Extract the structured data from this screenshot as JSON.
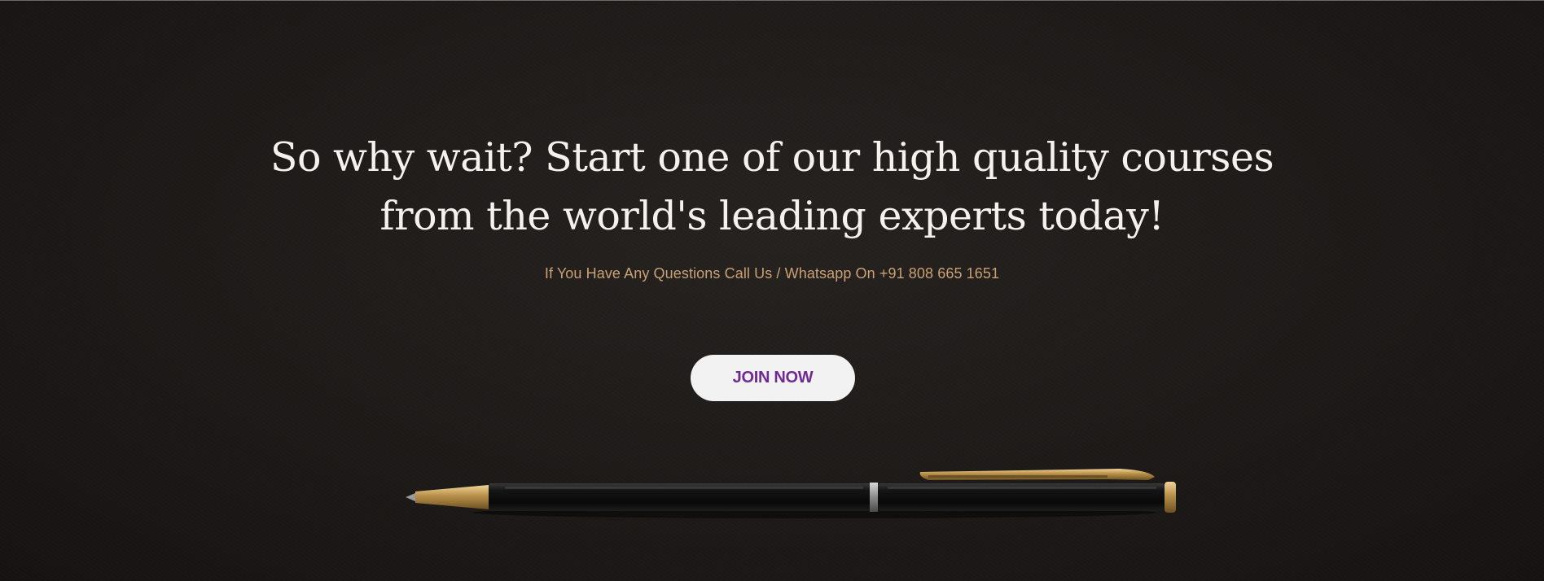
{
  "cta": {
    "headline_line1": "So why wait? Start one of our high quality courses",
    "headline_line2": "from the world's leading experts today!",
    "contact_text": "If You Have Any Questions Call Us / Whatsapp On +91 808 665 1651",
    "button_label": "JOIN NOW"
  },
  "background": {
    "image": "pen-icon",
    "base_color": "#1b1817"
  },
  "colors": {
    "headline": "#f5f1ec",
    "contact_text": "#c9a174",
    "button_bg": "#f2f2f2",
    "button_text": "#6f2b92",
    "pen_gold": "#c9a45a"
  }
}
